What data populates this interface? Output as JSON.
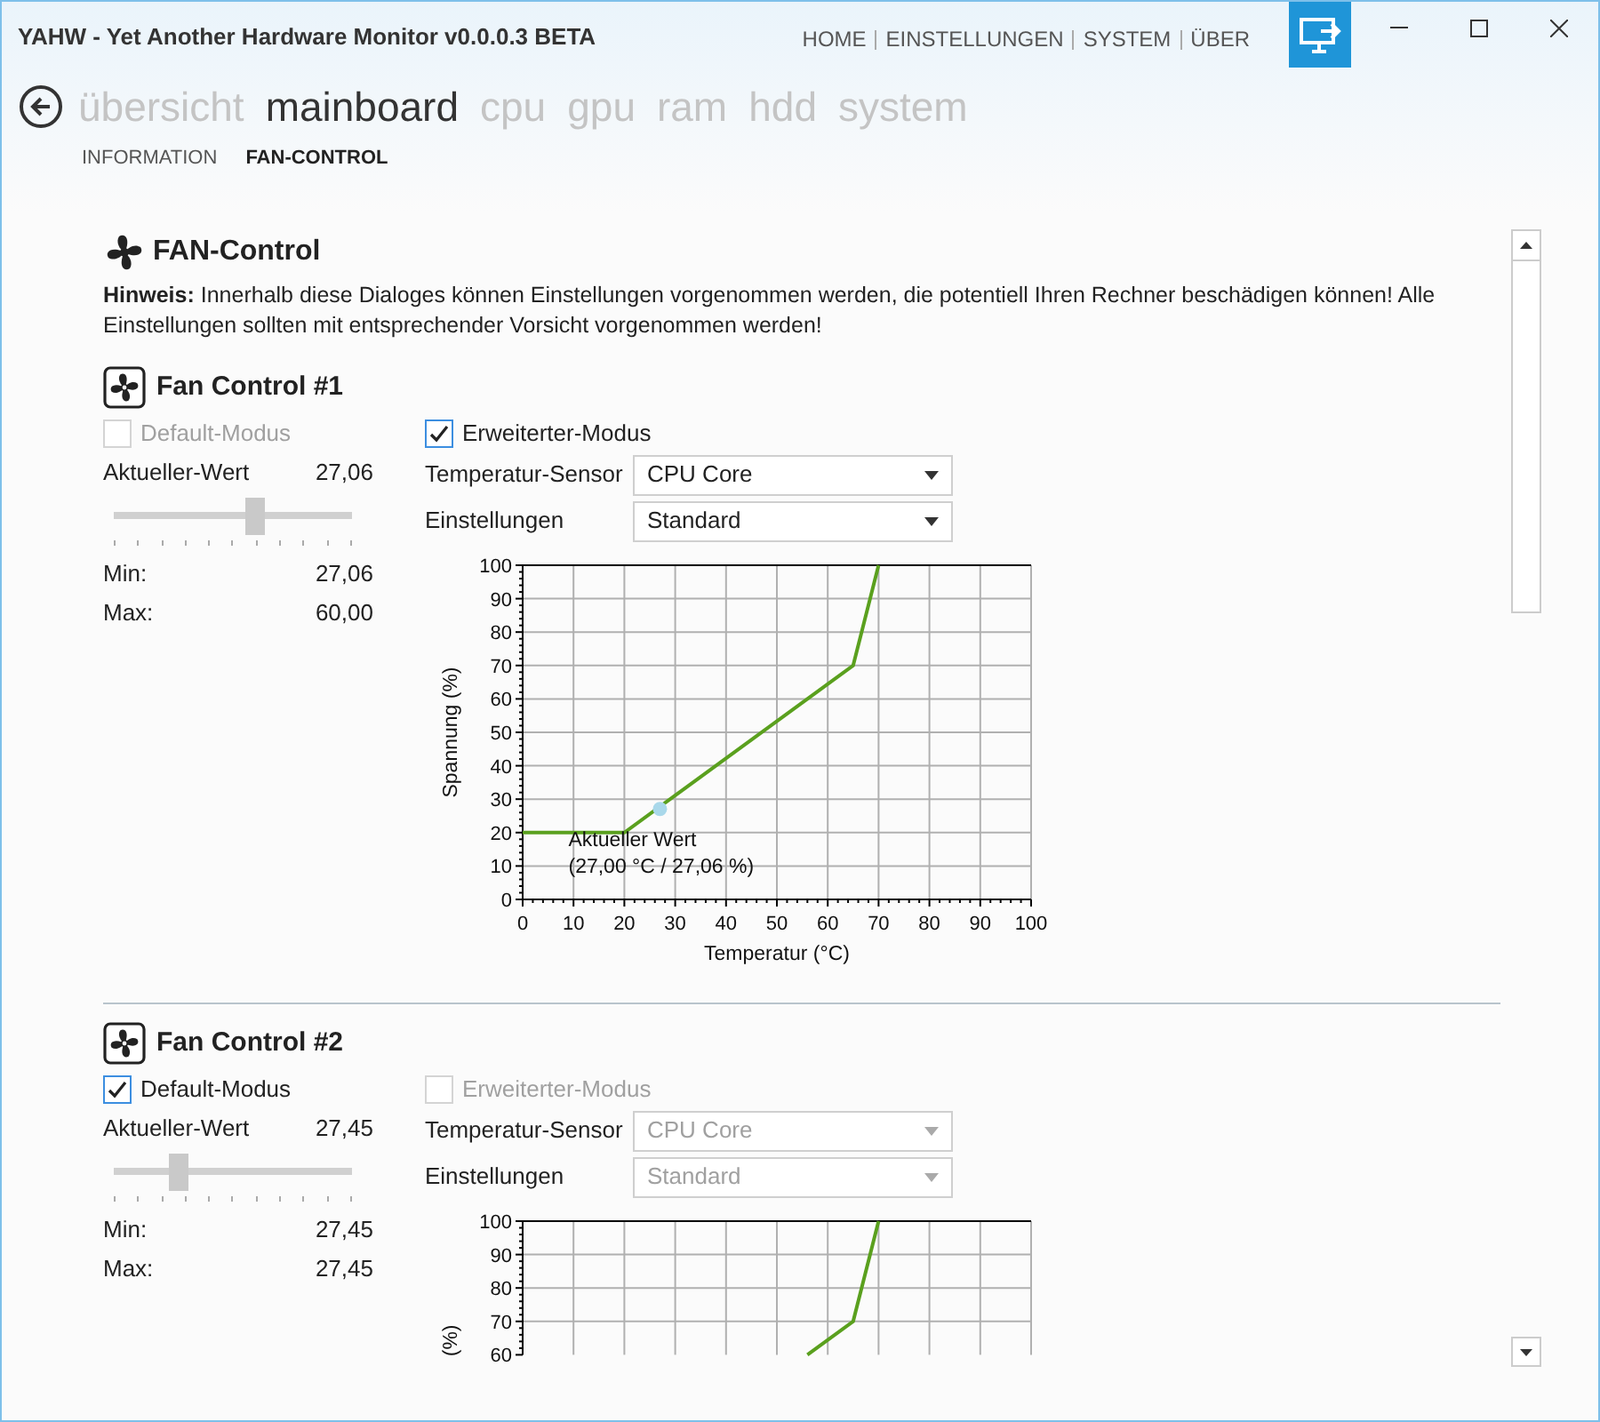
{
  "window": {
    "title": "YAHW - Yet Another Hardware Monitor v0.0.0.3 BETA"
  },
  "top_menu": [
    "HOME",
    "EINSTELLUNGEN",
    "SYSTEM",
    "ÜBER"
  ],
  "nav": [
    {
      "label": "übersicht",
      "selected": false
    },
    {
      "label": "mainboard",
      "selected": true
    },
    {
      "label": "cpu",
      "selected": false
    },
    {
      "label": "gpu",
      "selected": false
    },
    {
      "label": "ram",
      "selected": false
    },
    {
      "label": "hdd",
      "selected": false
    },
    {
      "label": "system",
      "selected": false
    }
  ],
  "subnav": [
    {
      "label": "INFORMATION",
      "selected": false
    },
    {
      "label": "FAN-CONTROL",
      "selected": true
    }
  ],
  "section": {
    "title": "FAN-Control",
    "notice": "**Hinweis:** Innerhalb diese Dialoges können Einstellungen vorgenommen werden, die potentiell Ihren Rechner beschädigen können! Alle Einstellungen sollten mit entsprechender Vorsicht vorgenommen werden!"
  },
  "fans": [
    {
      "title": "Fan Control #1",
      "default_mode": {
        "label": "Default-Modus",
        "checked": false,
        "disabled": true
      },
      "advanced_mode": {
        "label": "Erweiterter-Modus",
        "checked": true,
        "disabled": false
      },
      "current": {
        "label": "Aktueller-Wert",
        "value": "27,06"
      },
      "slider": {
        "level": 0.59
      },
      "min": {
        "label": "Min:",
        "value": "27,06"
      },
      "max": {
        "label": "Max:",
        "value": "60,00"
      },
      "sensor": {
        "label": "Temperatur-Sensor",
        "value": "CPU Core",
        "disabled": false
      },
      "settings": {
        "label": "Einstellungen",
        "value": "Standard",
        "disabled": false
      },
      "chart_data": {
        "type": "line",
        "xlabel": "Temperatur (°C)",
        "ylabel": "Spannung (%)",
        "x": [
          0,
          20,
          65,
          70
        ],
        "series": [
          {
            "color": "#5aa01e",
            "values": [
              20,
              20,
              70,
              100
            ]
          }
        ],
        "xlim": [
          0,
          100
        ],
        "ylim": [
          0,
          100
        ],
        "xticks": [
          0,
          10,
          20,
          30,
          40,
          50,
          60,
          70,
          80,
          90,
          100
        ],
        "yticks": [
          0,
          10,
          20,
          30,
          40,
          50,
          60,
          70,
          80,
          90,
          100
        ],
        "grid": true,
        "annotations": [
          {
            "x": 27,
            "y": 27.06,
            "text": "Aktueller Wert\n(27,00 °C / 27,06 %)"
          }
        ]
      }
    },
    {
      "title": "Fan Control #2",
      "default_mode": {
        "label": "Default-Modus",
        "checked": true,
        "disabled": false
      },
      "advanced_mode": {
        "label": "Erweiterter-Modus",
        "checked": false,
        "disabled": true
      },
      "current": {
        "label": "Aktueller-Wert",
        "value": "27,45"
      },
      "slider": {
        "level": 0.27
      },
      "min": {
        "label": "Min:",
        "value": "27,45"
      },
      "max": {
        "label": "Max:",
        "value": "27,45"
      },
      "sensor": {
        "label": "Temperatur-Sensor",
        "value": "CPU Core",
        "disabled": true
      },
      "settings": {
        "label": "Einstellungen",
        "value": "Standard",
        "disabled": true
      },
      "chart_data": {
        "type": "line",
        "ylabel": "(%)",
        "x": [
          56,
          65,
          70
        ],
        "series": [
          {
            "color": "#5aa01e",
            "values": [
              60,
              70,
              100
            ]
          }
        ],
        "xlim": [
          0,
          100
        ],
        "ylim": [
          60,
          100
        ],
        "yticks": [
          60,
          70,
          80,
          90,
          100
        ],
        "grid": true
      }
    }
  ]
}
